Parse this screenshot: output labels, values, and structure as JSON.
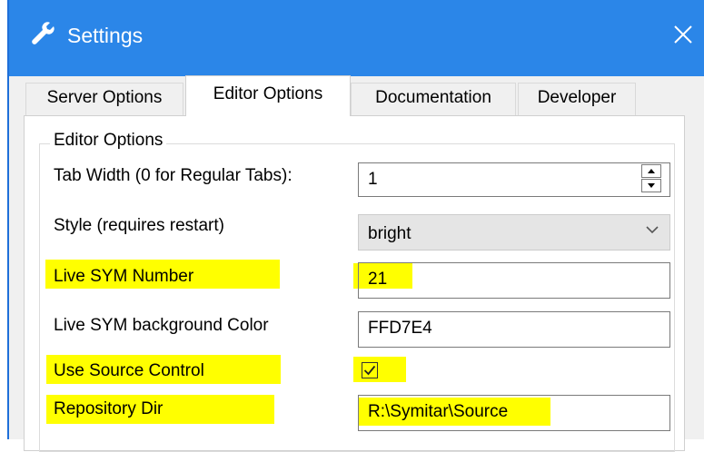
{
  "window": {
    "title": "Settings",
    "icon": "wrench-icon",
    "close_icon": "close-icon"
  },
  "colors": {
    "titlebar": "#2b86e8",
    "highlight": "#ffff00",
    "selected_field": "#e5e5e5"
  },
  "tabs": [
    {
      "label": "Server Options",
      "active": false
    },
    {
      "label": "Editor Options",
      "active": true
    },
    {
      "label": "Documentation",
      "active": false
    },
    {
      "label": "Developer",
      "active": false
    }
  ],
  "editor_options": {
    "group_title": "Editor Options",
    "tab_width": {
      "label": "Tab Width (0 for Regular Tabs):",
      "value": "1"
    },
    "style": {
      "label": "Style (requires restart)",
      "value": "bright"
    },
    "live_sym_number": {
      "label": "Live SYM Number",
      "value": "21"
    },
    "live_sym_bg_color": {
      "label": "Live SYM background Color",
      "value": "FFD7E4"
    },
    "use_source_control": {
      "label": "Use Source Control",
      "checked": true
    },
    "repository_dir": {
      "label": "Repository Dir",
      "value": "R:\\Symitar\\Source"
    }
  }
}
